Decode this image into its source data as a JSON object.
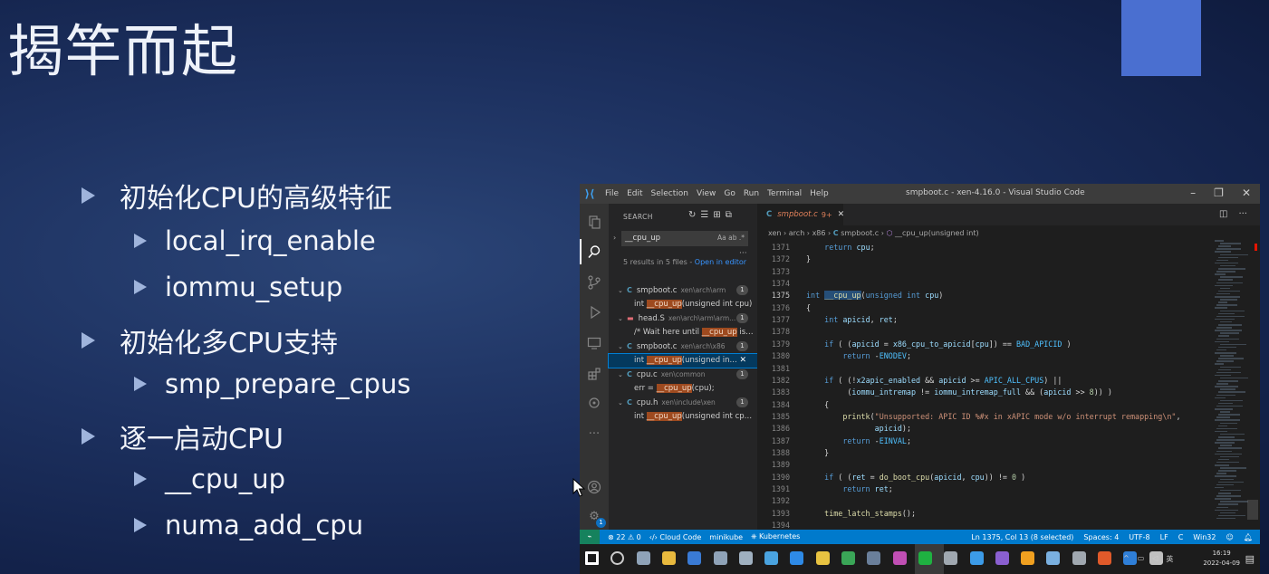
{
  "slide": {
    "title": "揭竿而起",
    "bullets": [
      {
        "text": "初始化CPU的高级特征",
        "level": 1
      },
      {
        "text": "local_irq_enable",
        "level": 2
      },
      {
        "text": "iommu_setup",
        "level": 2
      },
      {
        "text": "初始化多CPU支持",
        "level": 1
      },
      {
        "text": "smp_prepare_cpus",
        "level": 2
      },
      {
        "text": "逐一启动CPU",
        "level": 1
      },
      {
        "text": "__cpu_up",
        "level": 2
      },
      {
        "text": "numa_add_cpu",
        "level": 2
      }
    ]
  },
  "vscode": {
    "menu": [
      "File",
      "Edit",
      "Selection",
      "View",
      "Go",
      "Run",
      "Terminal",
      "Help"
    ],
    "window_title": "smpboot.c - xen-4.16.0 - Visual Studio Code",
    "sidebar": {
      "header": "SEARCH",
      "search_value": "__cpu_up",
      "search_options": "Aa  ab  .*",
      "results_summary": "5 results in 5 files - ",
      "open_in_editor": "Open in editor",
      "results": [
        {
          "kind": "file",
          "type": "C",
          "name": "smpboot.c",
          "path": "xen\\arch\\arm",
          "count": "1"
        },
        {
          "kind": "match",
          "before": "int ",
          "match": "__cpu_up",
          "after": "(unsigned int cpu)"
        },
        {
          "kind": "file",
          "type": "ASM",
          "name": "head.S",
          "path": "xen\\arch\\arm\\arm...",
          "count": "1"
        },
        {
          "kind": "match",
          "before": "/* Wait here until ",
          "match": "__cpu_up",
          "after": " is re..."
        },
        {
          "kind": "file",
          "type": "C",
          "name": "smpboot.c",
          "path": "xen\\arch\\x86",
          "count": "1"
        },
        {
          "kind": "match",
          "before": "int ",
          "match": "__cpu_up",
          "after": "(unsigned in...",
          "selected": true
        },
        {
          "kind": "file",
          "type": "C",
          "name": "cpu.c",
          "path": "xen\\common",
          "count": "1"
        },
        {
          "kind": "match",
          "before": "err = ",
          "match": "__cpu_up",
          "after": "(cpu);"
        },
        {
          "kind": "file",
          "type": "C",
          "name": "cpu.h",
          "path": "xen\\include\\xen",
          "count": "1"
        },
        {
          "kind": "match",
          "before": "int ",
          "match": "__cpu_up",
          "after": "(unsigned int cpun..."
        }
      ]
    },
    "tab": {
      "type": "C",
      "name": "smpboot.c",
      "modified": "9+"
    },
    "breadcrumbs": {
      "parts": [
        "xen",
        "arch",
        "x86"
      ],
      "file": "smpboot.c",
      "symbol": "__cpu_up(unsigned int)"
    },
    "code_lines": [
      {
        "n": "1371",
        "t": "    return cpu;"
      },
      {
        "n": "1372",
        "t": "}"
      },
      {
        "n": "1373",
        "t": ""
      },
      {
        "n": "1374",
        "t": ""
      },
      {
        "n": "1375",
        "t": "int __cpu_up(unsigned int cpu)"
      },
      {
        "n": "1376",
        "t": "{"
      },
      {
        "n": "1377",
        "t": "    int apicid, ret;"
      },
      {
        "n": "1378",
        "t": ""
      },
      {
        "n": "1379",
        "t": "    if ( (apicid = x86_cpu_to_apicid[cpu]) == BAD_APICID )"
      },
      {
        "n": "1380",
        "t": "        return -ENODEV;"
      },
      {
        "n": "1381",
        "t": ""
      },
      {
        "n": "1382",
        "t": "    if ( (!x2apic_enabled && apicid >= APIC_ALL_CPUS) ||"
      },
      {
        "n": "1383",
        "t": "         (iommu_intremap != iommu_intremap_full && (apicid >> 8)) )"
      },
      {
        "n": "1384",
        "t": "    {"
      },
      {
        "n": "1385",
        "t": "        printk(\"Unsupported: APIC ID %#x in xAPIC mode w/o interrupt remapping\\n\","
      },
      {
        "n": "1386",
        "t": "               apicid);"
      },
      {
        "n": "1387",
        "t": "        return -EINVAL;"
      },
      {
        "n": "1388",
        "t": "    }"
      },
      {
        "n": "1389",
        "t": ""
      },
      {
        "n": "1390",
        "t": "    if ( (ret = do_boot_cpu(apicid, cpu)) != 0 )"
      },
      {
        "n": "1391",
        "t": "        return ret;"
      },
      {
        "n": "1392",
        "t": ""
      },
      {
        "n": "1393",
        "t": "    time_latch_stamps();"
      },
      {
        "n": "1394",
        "t": ""
      }
    ],
    "current_line": "1375",
    "statusbar": {
      "errors": "⊗ 22 ⚠ 0",
      "cloud_code": "‹/› Cloud Code",
      "minikube": "minikube",
      "kubernetes": "⎈ Kubernetes",
      "position": "Ln 1375, Col 13 (8 selected)",
      "spaces": "Spaces: 4",
      "encoding": "UTF-8",
      "eol": "LF",
      "language": "C",
      "platform": "Win32"
    },
    "taskbar": {
      "time": "16:19",
      "date": "2022-04-09",
      "ime": "英"
    }
  },
  "colors": {
    "accent_square": "#4a6fd0",
    "status_bar": "#007acc",
    "search_highlight": "#9e4a1f"
  }
}
